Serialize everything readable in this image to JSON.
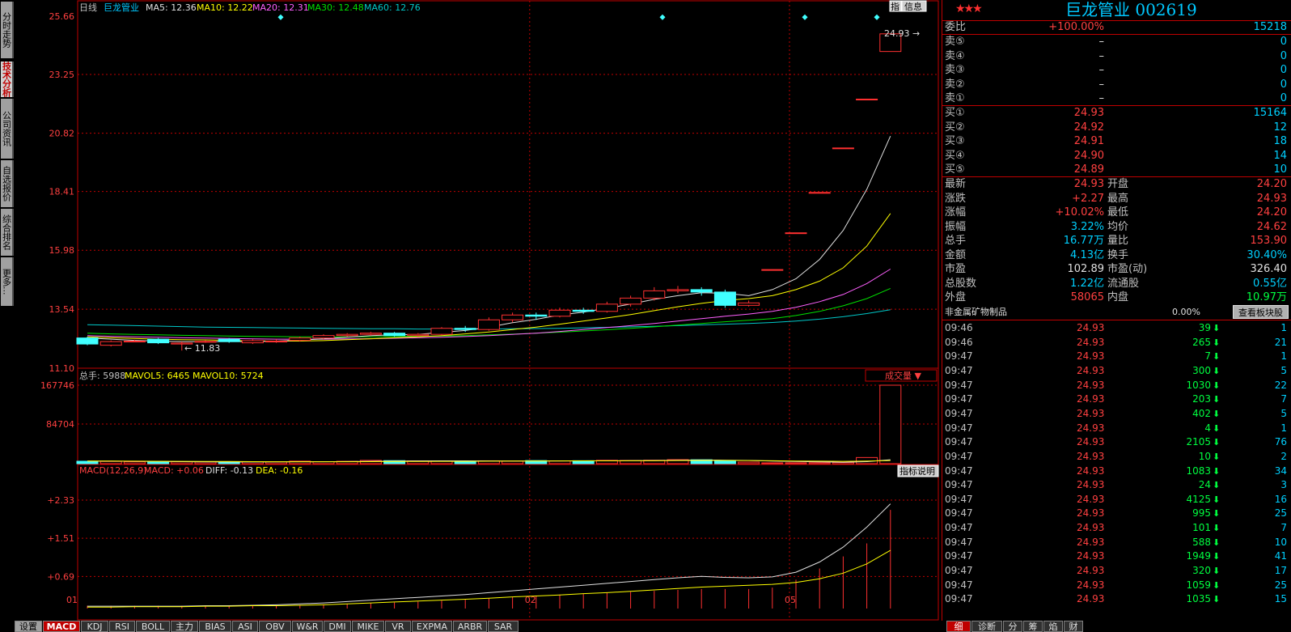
{
  "side_tabs": [
    "分时走势",
    "技术分析",
    "公司资讯",
    "自选报价",
    "综合排名",
    "更多..."
  ],
  "side_active": 1,
  "chart_header": {
    "period": "日线",
    "name": "巨龙管业",
    "ma5": "MA5: 12.36",
    "ma10": "MA10: 12.22",
    "ma20": "MA20: 12.31",
    "ma30": "MA30: 12.48",
    "ma60": "MA60: 12.76",
    "btn_zhi": "指",
    "btn_info": "信息"
  },
  "colors": {
    "ma5": "#e0e0e0",
    "ma10": "#ffff00",
    "ma20": "#ff60ff",
    "ma30": "#00e000",
    "ma60": "#00c8c8",
    "up": "#ff3030",
    "down": "#40ffff",
    "grid": "#c00000"
  },
  "price_axis": [
    "25.66",
    "23.25",
    "20.82",
    "18.41",
    "15.98",
    "13.54",
    "11.10"
  ],
  "price_labels": {
    "high": "24.93",
    "low": "11.83"
  },
  "vol_header": {
    "total": "总手: 5988",
    "mavol5": "MAVOL5: 6465",
    "mavol10": "MAVOL10: 5724",
    "selector": "成交量"
  },
  "vol_axis": [
    "167746",
    "84704"
  ],
  "macd_header": {
    "name": "MACD(12,26,9)",
    "macd": "MACD: +0.06",
    "diff": "DIFF: -0.13",
    "dea": "DEA: -0.16",
    "btn": "指标说明"
  },
  "macd_axis": [
    "+2.33",
    "+1.51",
    "+0.69"
  ],
  "date_axis": [
    "01",
    "02",
    "05"
  ],
  "chart_data": {
    "type": "candlestick",
    "title": "巨龙管业 日线",
    "ylim": [
      11.1,
      25.66
    ],
    "candles": [
      {
        "o": 12.35,
        "c": 12.1,
        "h": 12.4,
        "l": 12.05
      },
      {
        "o": 12.05,
        "c": 12.2,
        "h": 12.25,
        "l": 12.0
      },
      {
        "o": 12.2,
        "c": 12.22,
        "h": 12.28,
        "l": 12.18
      },
      {
        "o": 12.3,
        "c": 12.15,
        "h": 12.35,
        "l": 12.1
      },
      {
        "o": 12.1,
        "c": 12.14,
        "h": 12.2,
        "l": 11.83
      },
      {
        "o": 12.2,
        "c": 12.21,
        "h": 12.25,
        "l": 12.15
      },
      {
        "o": 12.3,
        "c": 12.2,
        "h": 12.35,
        "l": 12.15
      },
      {
        "o": 12.15,
        "c": 12.24,
        "h": 12.3,
        "l": 12.1
      },
      {
        "o": 12.2,
        "c": 12.22,
        "h": 12.3,
        "l": 12.15
      },
      {
        "o": 12.25,
        "c": 12.35,
        "h": 12.4,
        "l": 12.2
      },
      {
        "o": 12.35,
        "c": 12.45,
        "h": 12.5,
        "l": 12.3
      },
      {
        "o": 12.45,
        "c": 12.5,
        "h": 12.55,
        "l": 12.4
      },
      {
        "o": 12.5,
        "c": 12.55,
        "h": 12.6,
        "l": 12.45
      },
      {
        "o": 12.55,
        "c": 12.45,
        "h": 12.6,
        "l": 12.4
      },
      {
        "o": 12.45,
        "c": 12.5,
        "h": 12.55,
        "l": 12.4
      },
      {
        "o": 12.5,
        "c": 12.75,
        "h": 12.8,
        "l": 12.45
      },
      {
        "o": 12.75,
        "c": 12.7,
        "h": 12.85,
        "l": 12.6
      },
      {
        "o": 12.7,
        "c": 13.1,
        "h": 13.2,
        "l": 12.65
      },
      {
        "o": 13.1,
        "c": 13.3,
        "h": 13.4,
        "l": 13.0
      },
      {
        "o": 13.3,
        "c": 13.25,
        "h": 13.4,
        "l": 13.1
      },
      {
        "o": 13.25,
        "c": 13.5,
        "h": 13.6,
        "l": 13.2
      },
      {
        "o": 13.5,
        "c": 13.45,
        "h": 13.6,
        "l": 13.35
      },
      {
        "o": 13.45,
        "c": 13.75,
        "h": 13.85,
        "l": 13.4
      },
      {
        "o": 13.75,
        "c": 14.0,
        "h": 14.1,
        "l": 13.65
      },
      {
        "o": 14.0,
        "c": 14.3,
        "h": 14.45,
        "l": 13.9
      },
      {
        "o": 14.3,
        "c": 14.35,
        "h": 14.5,
        "l": 14.2
      },
      {
        "o": 14.35,
        "c": 14.25,
        "h": 14.45,
        "l": 14.1
      },
      {
        "o": 14.25,
        "c": 13.7,
        "h": 14.35,
        "l": 13.6
      },
      {
        "o": 13.7,
        "c": 13.8,
        "h": 13.9,
        "l": 13.65
      },
      {
        "o": 15.18,
        "c": 15.18,
        "h": 15.18,
        "l": 15.18
      },
      {
        "o": 16.7,
        "c": 16.7,
        "h": 16.7,
        "l": 16.7
      },
      {
        "o": 18.37,
        "c": 18.37,
        "h": 18.37,
        "l": 18.37
      },
      {
        "o": 20.21,
        "c": 20.21,
        "h": 20.21,
        "l": 20.21
      },
      {
        "o": 22.23,
        "c": 22.23,
        "h": 22.23,
        "l": 22.23
      },
      {
        "o": 24.2,
        "c": 24.93,
        "h": 24.93,
        "l": 24.2
      }
    ],
    "ma5": [
      12.35,
      12.3,
      12.25,
      12.22,
      12.2,
      12.2,
      12.2,
      12.2,
      12.22,
      12.26,
      12.32,
      12.38,
      12.45,
      12.48,
      12.5,
      12.58,
      12.66,
      12.8,
      12.98,
      13.12,
      13.3,
      13.42,
      13.58,
      13.75,
      13.95,
      14.1,
      14.22,
      14.2,
      14.1,
      14.35,
      14.8,
      15.6,
      16.8,
      18.5,
      20.7
    ],
    "ma10": [
      12.4,
      12.36,
      12.33,
      12.3,
      12.28,
      12.27,
      12.25,
      12.23,
      12.22,
      12.22,
      12.24,
      12.28,
      12.32,
      12.36,
      12.4,
      12.45,
      12.52,
      12.6,
      12.7,
      12.8,
      12.92,
      13.05,
      13.18,
      13.32,
      13.48,
      13.64,
      13.78,
      13.9,
      13.98,
      14.1,
      14.35,
      14.7,
      15.25,
      16.15,
      17.5
    ],
    "ma20": [
      12.45,
      12.42,
      12.4,
      12.38,
      12.36,
      12.35,
      12.33,
      12.31,
      12.3,
      12.3,
      12.3,
      12.31,
      12.32,
      12.34,
      12.36,
      12.38,
      12.41,
      12.45,
      12.5,
      12.55,
      12.62,
      12.7,
      12.78,
      12.86,
      12.95,
      13.05,
      13.15,
      13.25,
      13.34,
      13.45,
      13.62,
      13.85,
      14.15,
      14.6,
      15.2
    ],
    "ma30": [
      12.55,
      12.52,
      12.5,
      12.48,
      12.46,
      12.45,
      12.43,
      12.42,
      12.41,
      12.4,
      12.4,
      12.4,
      12.4,
      12.41,
      12.42,
      12.43,
      12.45,
      12.48,
      12.51,
      12.55,
      12.59,
      12.64,
      12.69,
      12.75,
      12.81,
      12.88,
      12.95,
      13.02,
      13.08,
      13.15,
      13.28,
      13.45,
      13.68,
      13.98,
      14.4
    ],
    "ma60": [
      12.9,
      12.88,
      12.86,
      12.84,
      12.82,
      12.8,
      12.79,
      12.78,
      12.77,
      12.76,
      12.75,
      12.74,
      12.73,
      12.73,
      12.72,
      12.72,
      12.72,
      12.72,
      12.73,
      12.74,
      12.75,
      12.77,
      12.79,
      12.81,
      12.83,
      12.86,
      12.89,
      12.92,
      12.95,
      12.99,
      13.05,
      13.13,
      13.23,
      13.36,
      13.52
    ],
    "volumes": [
      5200,
      4800,
      3900,
      3600,
      3800,
      3500,
      3600,
      4200,
      3700,
      5400,
      4300,
      5100,
      7000,
      6500,
      6000,
      5800,
      5200,
      6100,
      5500,
      6600,
      5900,
      6300,
      7200,
      6900,
      7400,
      8600,
      8400,
      6100,
      3300,
      1800,
      1900,
      2100,
      2800,
      13200,
      167746
    ],
    "mavol5": [
      5500,
      5300,
      5000,
      4600,
      4300,
      3900,
      3700,
      3700,
      3800,
      4100,
      4200,
      4500,
      5100,
      5700,
      5800,
      6000,
      6100,
      5900,
      5700,
      5800,
      5900,
      6000,
      6300,
      6500,
      6700,
      7300,
      7700,
      7500,
      7000,
      5700,
      4800,
      3900,
      2900,
      4400,
      8500
    ],
    "mavol10": [
      5600,
      5500,
      5400,
      5200,
      5000,
      4800,
      4600,
      4400,
      4200,
      4200,
      4200,
      4200,
      4400,
      4700,
      4800,
      5000,
      5100,
      5300,
      5500,
      5700,
      5800,
      6000,
      6100,
      6200,
      6300,
      6700,
      6900,
      6900,
      6800,
      6300,
      5700,
      5400,
      5000,
      5600,
      6800
    ],
    "macd_bars": [
      0.06,
      0.06,
      0.06,
      0.06,
      0.06,
      0.06,
      0.06,
      0.07,
      0.07,
      0.08,
      0.09,
      0.1,
      0.12,
      0.13,
      0.15,
      0.17,
      0.19,
      0.22,
      0.25,
      0.28,
      0.3,
      0.32,
      0.34,
      0.36,
      0.38,
      0.4,
      0.42,
      0.42,
      0.42,
      0.45,
      0.62,
      0.86,
      1.12,
      1.4,
      2.12
    ],
    "diff": [
      0.05,
      0.05,
      0.05,
      0.05,
      0.05,
      0.06,
      0.06,
      0.07,
      0.08,
      0.1,
      0.12,
      0.15,
      0.18,
      0.21,
      0.24,
      0.27,
      0.3,
      0.34,
      0.38,
      0.42,
      0.46,
      0.5,
      0.54,
      0.58,
      0.62,
      0.66,
      0.69,
      0.67,
      0.66,
      0.68,
      0.78,
      1.0,
      1.32,
      1.75,
      2.25
    ],
    "dea": [
      0.03,
      0.03,
      0.04,
      0.04,
      0.04,
      0.05,
      0.05,
      0.06,
      0.06,
      0.07,
      0.08,
      0.1,
      0.12,
      0.14,
      0.16,
      0.18,
      0.2,
      0.22,
      0.25,
      0.27,
      0.29,
      0.32,
      0.34,
      0.37,
      0.4,
      0.43,
      0.46,
      0.48,
      0.5,
      0.52,
      0.56,
      0.64,
      0.76,
      0.96,
      1.25
    ]
  },
  "quote": {
    "title": "巨龙管业 002619",
    "stars": "★★★",
    "webi": {
      "label": "委比",
      "pct": "+100.00%",
      "val": "15218"
    },
    "sell": [
      {
        "label": "卖⑤",
        "price": "–",
        "vol": "0"
      },
      {
        "label": "卖④",
        "price": "–",
        "vol": "0"
      },
      {
        "label": "卖③",
        "price": "–",
        "vol": "0"
      },
      {
        "label": "卖②",
        "price": "–",
        "vol": "0"
      },
      {
        "label": "卖①",
        "price": "–",
        "vol": "0"
      }
    ],
    "buy": [
      {
        "label": "买①",
        "price": "24.93",
        "vol": "15164"
      },
      {
        "label": "买②",
        "price": "24.92",
        "vol": "12"
      },
      {
        "label": "买③",
        "price": "24.91",
        "vol": "18"
      },
      {
        "label": "买④",
        "price": "24.90",
        "vol": "14"
      },
      {
        "label": "买⑤",
        "price": "24.89",
        "vol": "10"
      }
    ],
    "stats": [
      {
        "l1": "最新",
        "v1": "24.93",
        "c1": "red",
        "l2": "开盘",
        "v2": "24.20",
        "c2": "red"
      },
      {
        "l1": "涨跌",
        "v1": "+2.27",
        "c1": "red",
        "l2": "最高",
        "v2": "24.93",
        "c2": "red"
      },
      {
        "l1": "涨幅",
        "v1": "+10.02%",
        "c1": "red",
        "l2": "最低",
        "v2": "24.20",
        "c2": "red"
      },
      {
        "l1": "振幅",
        "v1": "3.22%",
        "c1": "cyan",
        "l2": "均价",
        "v2": "24.62",
        "c2": "red"
      },
      {
        "l1": "总手",
        "v1": "16.77万",
        "c1": "cyan",
        "l2": "量比",
        "v2": "153.90",
        "c2": "red"
      },
      {
        "l1": "金额",
        "v1": "4.13亿",
        "c1": "cyan",
        "l2": "换手",
        "v2": "30.40%",
        "c2": "cyan"
      },
      {
        "l1": "市盈",
        "v1": "102.89",
        "c1": "white",
        "l2": "市盈(动)",
        "v2": "326.40",
        "c2": "white"
      },
      {
        "l1": "总股数",
        "v1": "1.22亿",
        "c1": "cyan",
        "l2": "流通股",
        "v2": "0.55亿",
        "c2": "cyan"
      },
      {
        "l1": "外盘",
        "v1": "58065",
        "c1": "red",
        "l2": "内盘",
        "v2": "10.97万",
        "c2": "green"
      }
    ],
    "industry": "非金属矿物制品",
    "industry_pct": "0.00%",
    "industry_btn": "查看板块股"
  },
  "ticks": [
    {
      "t": "09:46",
      "p": "24.93",
      "v": "39",
      "n": "1"
    },
    {
      "t": "09:46",
      "p": "24.93",
      "v": "265",
      "n": "21"
    },
    {
      "t": "09:47",
      "p": "24.93",
      "v": "7",
      "n": "1"
    },
    {
      "t": "09:47",
      "p": "24.93",
      "v": "300",
      "n": "5"
    },
    {
      "t": "09:47",
      "p": "24.93",
      "v": "1030",
      "n": "22"
    },
    {
      "t": "09:47",
      "p": "24.93",
      "v": "203",
      "n": "7"
    },
    {
      "t": "09:47",
      "p": "24.93",
      "v": "402",
      "n": "5"
    },
    {
      "t": "09:47",
      "p": "24.93",
      "v": "4",
      "n": "1"
    },
    {
      "t": "09:47",
      "p": "24.93",
      "v": "2105",
      "n": "76"
    },
    {
      "t": "09:47",
      "p": "24.93",
      "v": "10",
      "n": "2"
    },
    {
      "t": "09:47",
      "p": "24.93",
      "v": "1083",
      "n": "34"
    },
    {
      "t": "09:47",
      "p": "24.93",
      "v": "24",
      "n": "3"
    },
    {
      "t": "09:47",
      "p": "24.93",
      "v": "4125",
      "n": "16"
    },
    {
      "t": "09:47",
      "p": "24.93",
      "v": "995",
      "n": "25"
    },
    {
      "t": "09:47",
      "p": "24.93",
      "v": "101",
      "n": "7"
    },
    {
      "t": "09:47",
      "p": "24.93",
      "v": "588",
      "n": "10"
    },
    {
      "t": "09:47",
      "p": "24.93",
      "v": "1949",
      "n": "41"
    },
    {
      "t": "09:47",
      "p": "24.93",
      "v": "320",
      "n": "17"
    },
    {
      "t": "09:47",
      "p": "24.93",
      "v": "1059",
      "n": "25"
    },
    {
      "t": "09:47",
      "p": "24.93",
      "v": "1035",
      "n": "15"
    }
  ],
  "bottom_tabs": [
    "设置",
    "MACD",
    "KDJ",
    "RSI",
    "BOLL",
    "主力",
    "BIAS",
    "ASI",
    "OBV",
    "W&R",
    "DMI",
    "MIKE",
    "VR",
    "EXPMA",
    "ARBR",
    "SAR"
  ],
  "bottom_active": 1,
  "right_tabs": [
    "细",
    "诊断",
    "分",
    "筹",
    "焰",
    "财"
  ],
  "right_active": 0
}
